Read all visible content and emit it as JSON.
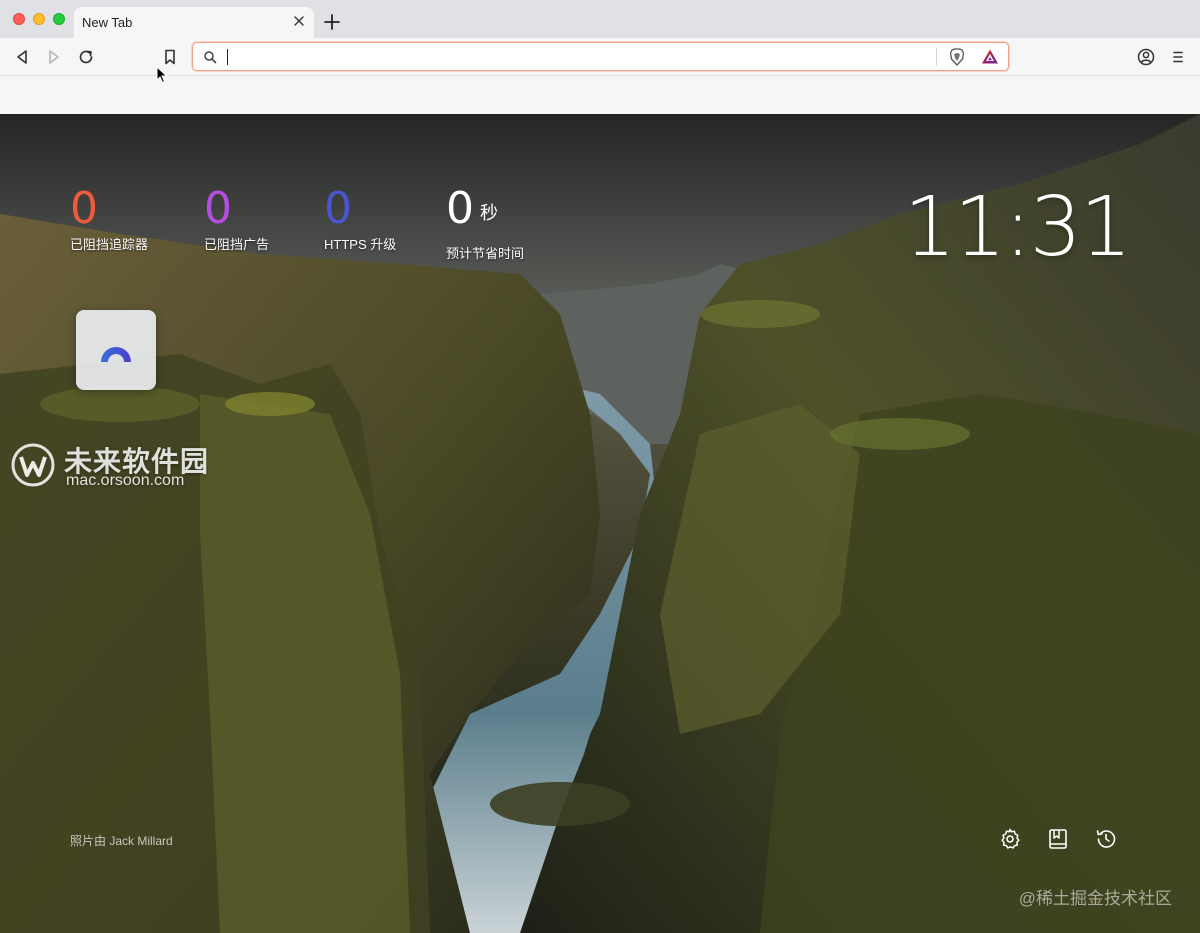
{
  "window": {
    "tab_title": "New Tab"
  },
  "toolbar": {
    "address_value": "",
    "icons": [
      "back-icon",
      "forward-icon",
      "reload-icon",
      "bookmark-icon",
      "search-icon",
      "brave-shields-icon",
      "brave-rewards-icon",
      "profile-icon",
      "menu-icon"
    ]
  },
  "stats": {
    "trackers": {
      "value": "0",
      "label": "已阻挡追踪器",
      "color": "#ef5a3c"
    },
    "ads": {
      "value": "0",
      "label": "已阻挡广告",
      "color": "#b24ee0"
    },
    "https": {
      "value": "0",
      "label": "HTTPS 升级",
      "color": "#4c54d2"
    },
    "time": {
      "value": "0",
      "unit": "秒",
      "label": "预计节省时间",
      "color": "#ffffff"
    }
  },
  "clock": "11:31",
  "watermark": {
    "title": "未来软件园",
    "url": "mac.orsoon.com"
  },
  "photo_credit": "照片由 Jack Millard",
  "bottom_icons": [
    "settings-icon",
    "bookmarks-manager-icon",
    "history-icon"
  ],
  "juejin_watermark": "@稀土掘金技术社区"
}
